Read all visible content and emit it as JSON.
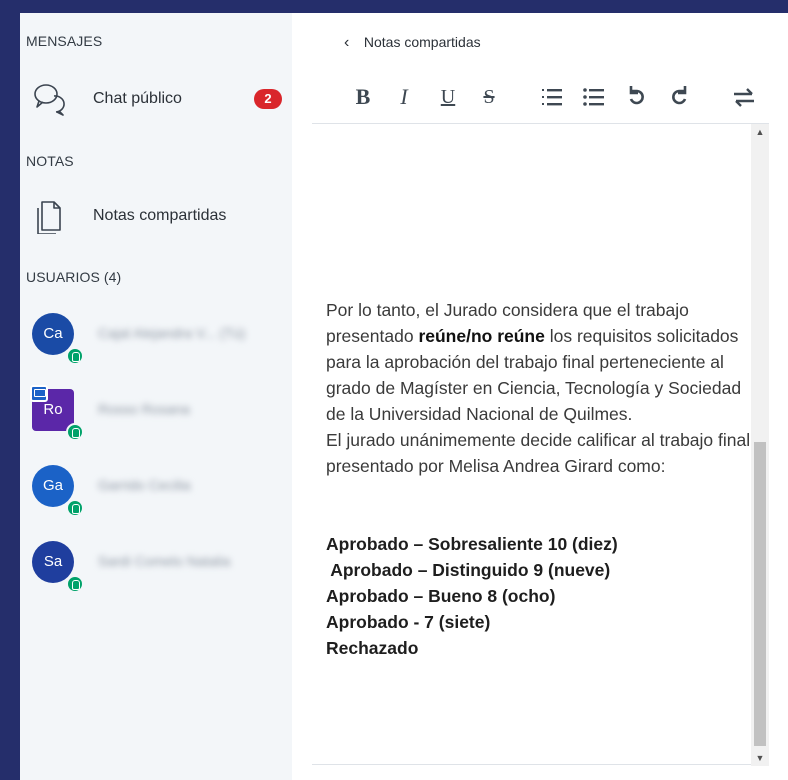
{
  "sidebar": {
    "messages_title": "MENSAJES",
    "chat": {
      "label": "Chat público",
      "badge": "2",
      "icon": "chat-bubbles-icon"
    },
    "notes_title": "NOTAS",
    "notes": {
      "label": "Notas compartidas",
      "icon": "document-icon"
    },
    "users_title": "USUARIOS (4)",
    "users": [
      {
        "initials": "Ca",
        "name": "Cajal Alejandra V... (Tú)",
        "color": "#1a4ba6",
        "shape": "round"
      },
      {
        "initials": "Ro",
        "name": "Rosso Rosana",
        "color": "#5b27a8",
        "shape": "square",
        "presenter": true
      },
      {
        "initials": "Ga",
        "name": "Garrido Cecilia",
        "color": "#1b62c7",
        "shape": "round"
      },
      {
        "initials": "Sa",
        "name": "Sardi Comelo Natalia",
        "color": "#1f3e9e",
        "shape": "round"
      }
    ]
  },
  "notes_panel": {
    "back_label": "Notas compartidas",
    "toolbar": {
      "bold": "B",
      "italic": "I",
      "underline": "U",
      "strike": "S",
      "ordered_list": "⁝≡",
      "bullet_list": "≔",
      "undo": "↺",
      "redo": "↻",
      "import": "⇄"
    },
    "document": {
      "p1_a": "Por lo tanto, el Jurado considera que el trabajo presentado ",
      "p1_strong": "reúne/no reúne",
      "p1_b": " los requisitos solicitados para la aprobación del trabajo final perteneciente al grado de Magíster en Ciencia, Tecnología y Sociedad de la Universidad Nacional de Quilmes.",
      "p2": "El jurado unánimemente decide calificar al trabajo final presentado por Melisa Andrea Girard como:",
      "options": [
        "Aprobado – Sobresaliente 10 (diez)",
        " Aprobado – Distinguido 9 (nueve)",
        "Aprobado – Bueno 8 (ocho)",
        "Aprobado - 7 (siete)",
        "Rechazado"
      ]
    }
  },
  "colors": {
    "background": "#252e6b",
    "sidebar": "#f3f6f9",
    "badge": "#d9262b",
    "status_online": "#00a26a"
  }
}
